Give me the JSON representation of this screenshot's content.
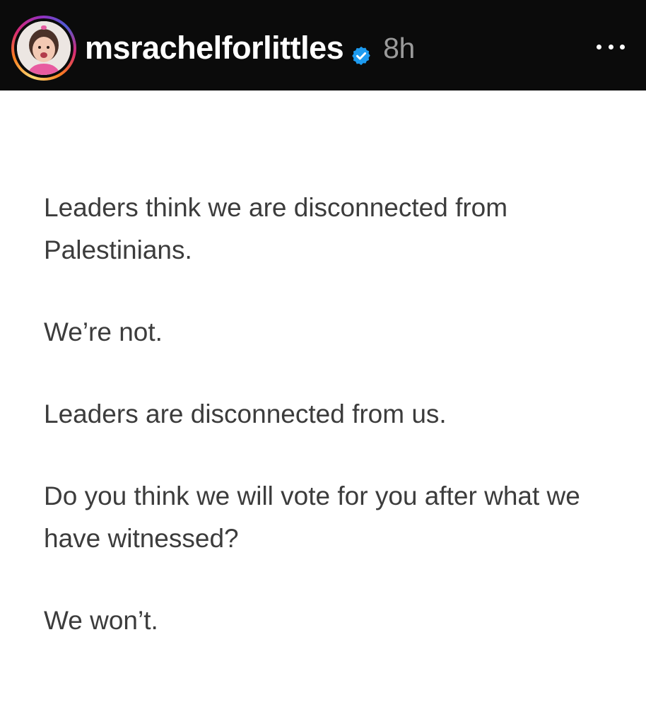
{
  "header": {
    "username": "msrachelforlittles",
    "time": "8h",
    "verified_icon": "verified-badge-icon",
    "more_icon": "more-horizontal-icon",
    "verified_color": "#1d9bf0",
    "story_ring_colors": [
      "#feda75",
      "#fa7e1e",
      "#d62976",
      "#962fbf",
      "#4f5bd5"
    ]
  },
  "post": {
    "paragraphs": [
      "Leaders think we are disconnected from Palestinians.",
      "We’re not.",
      "Leaders are disconnected from us.",
      "Do you think we will vote for you after what we have witnessed?",
      "We won’t."
    ]
  }
}
